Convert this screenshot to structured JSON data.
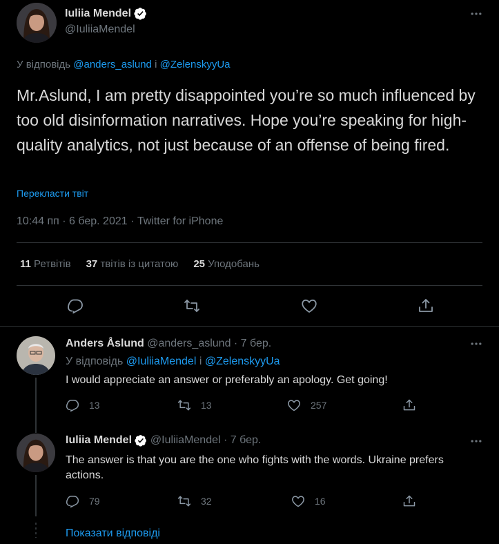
{
  "main_tweet": {
    "author_name": "Iuliia Mendel",
    "handle": "@IuliiaMendel",
    "reply_prefix": "У відповідь",
    "mention1": "@anders_aslund",
    "reply_connector": "і",
    "mention2": "@ZelenskyyUa",
    "text": "Mr.Aslund, I am pretty disappointed you’re so much influenced by too old disinformation narratives. Hope you’re speaking for high-quality analytics, not just because of an offense of being fired.",
    "translate_link": "Перекласти твіт",
    "meta": "10:44 пп · 6 бер. 2021 · Twitter for iPhone",
    "retweets_count": "11",
    "retweets_label": "Ретвітів",
    "quotes_count": "37",
    "quotes_label": "твітів із цитатою",
    "likes_count": "25",
    "likes_label": "Уподобань"
  },
  "reply1": {
    "author_name": "Anders Åslund",
    "handle_date": "@anders_aslund · 7 бер.",
    "reply_prefix": "У відповідь",
    "mention1": "@IuliiaMendel",
    "reply_connector": "і",
    "mention2": "@ZelenskyyUa",
    "text": "I would appreciate an answer or preferably an apology. Get going!",
    "reply_count": "13",
    "retweet_count": "13",
    "like_count": "257"
  },
  "reply2": {
    "author_name": "Iuliia Mendel",
    "handle_date": "@IuliiaMendel · 7 бер.",
    "text": "The answer is that you are the one who fights with the words. Ukraine prefers actions.",
    "reply_count": "79",
    "retweet_count": "32",
    "like_count": "16"
  },
  "show_replies": "Показати відповіді",
  "colors": {
    "background": "#000000",
    "accent": "#1d9bf0",
    "muted": "#6e767d",
    "text": "#d9d9d9",
    "divider": "#2f3336"
  },
  "icons": [
    "more-icon",
    "verified-icon",
    "reply-icon",
    "retweet-icon",
    "like-icon",
    "share-icon"
  ]
}
